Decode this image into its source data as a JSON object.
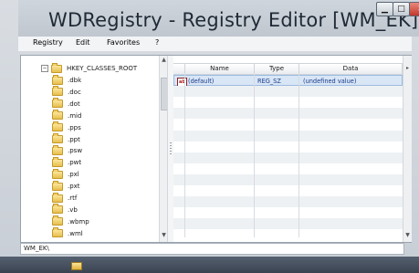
{
  "window": {
    "title": "WDRegistry - Registry Editor [WM_EK]"
  },
  "menubar": {
    "items": [
      "Registry",
      "Edit",
      "Favorites",
      "?"
    ]
  },
  "tree": {
    "root": "HKEY_CLASSES_ROOT",
    "items": [
      ".dbk",
      ".doc",
      ".dot",
      ".mid",
      ".pps",
      ".ppt",
      ".psw",
      ".pwt",
      ".pxl",
      ".pxt",
      ".rtf",
      ".vb",
      ".wbmp",
      ".wml"
    ]
  },
  "list": {
    "columns": [
      "Name",
      "Type",
      "Data"
    ],
    "rows": [
      {
        "name": "(default)",
        "type": "REG_SZ",
        "data": "(undefined value)",
        "icon": "ab"
      }
    ]
  },
  "status": {
    "path": "WM_EK\\"
  }
}
